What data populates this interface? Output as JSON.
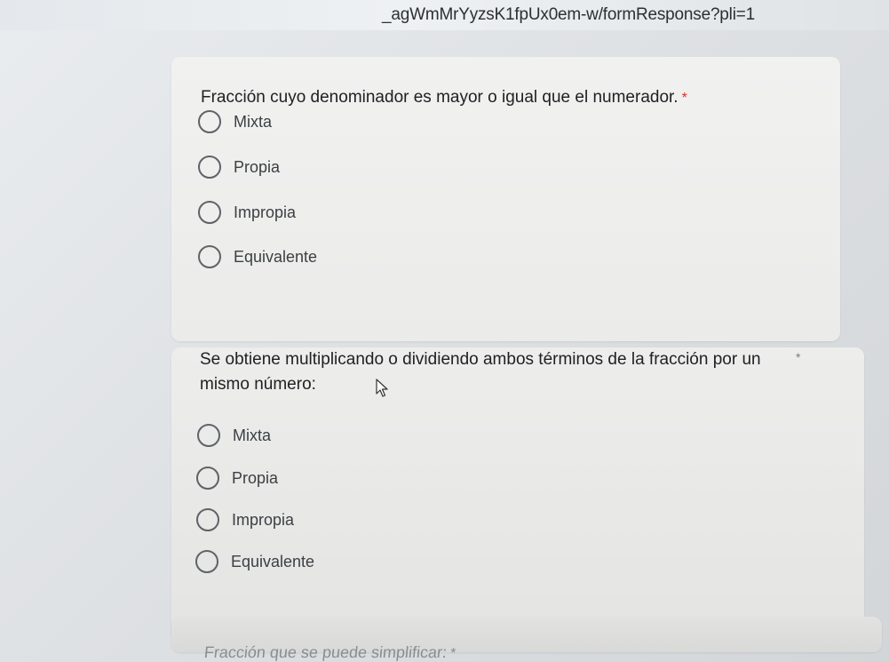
{
  "browser": {
    "url": "_agWmMrYyzsK1fpUx0em-w/formResponse?pli=1"
  },
  "questions": [
    {
      "text": "Fracción cuyo denominador es mayor o igual que el numerador.",
      "required_mark": "*",
      "options": [
        "Mixta",
        "Propia",
        "Impropia",
        "Equivalente"
      ]
    },
    {
      "text": "Se obtiene multiplicando o dividiendo ambos términos de la fracción por un mismo número:",
      "required_mark": "*",
      "options": [
        "Mixta",
        "Propia",
        "Impropia",
        "Equivalente"
      ]
    },
    {
      "text": "Fracción que se puede simplificar:",
      "required_mark": "*"
    }
  ],
  "colors": {
    "required": "#d93025",
    "radio_border": "#5f6368",
    "card_bg": "#eeeeec"
  },
  "icons": {
    "cursor": "mouse-pointer-icon",
    "radio": "radio-unchecked-icon"
  }
}
